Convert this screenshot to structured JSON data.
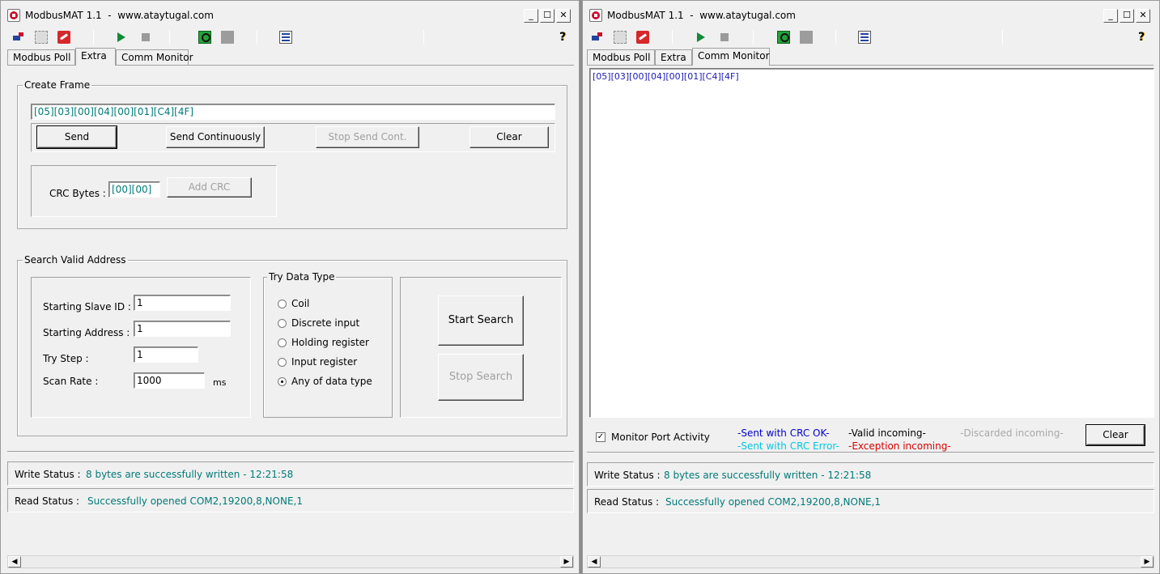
{
  "title": "ModbusMAT 1.1  -  www.ataytugal.com",
  "window_buttons": {
    "minimize": "_",
    "maximize": "☐",
    "close": "✕"
  },
  "toolbar": {
    "help": "?"
  },
  "tabs": [
    "Modbus Poll",
    "Extra",
    "Comm Monitor"
  ],
  "left": {
    "active_tab": "Extra",
    "create_frame": {
      "title": "Create Frame",
      "frame_value": "[05][03][00][04][00][01][C4][4F]",
      "send": "Send",
      "send_continuously": "Send Continuously",
      "stop_send_cont": "Stop Send Cont.",
      "clear": "Clear",
      "crc_label": "CRC Bytes :",
      "crc_value": "[00][00]",
      "add_crc": "Add CRC"
    },
    "search": {
      "title": "Search Valid Address",
      "starting_slave_id_label": "Starting Slave ID :",
      "starting_slave_id": "1",
      "starting_address_label": "Starting Address :",
      "starting_address": "1",
      "try_step_label": "Try Step :",
      "try_step": "1",
      "scan_rate_label": "Scan Rate :",
      "scan_rate": "1000",
      "scan_rate_unit": "ms",
      "data_type_title": "Try Data Type",
      "data_types": [
        "Coil",
        "Discrete input",
        "Holding register",
        "Input register",
        "Any of data type"
      ],
      "selected_data_type": "Any of data type",
      "start_search": "Start Search",
      "stop_search": "Stop Search"
    }
  },
  "right": {
    "active_tab": "Comm Monitor",
    "monitor_text": "[05][03][00][04][00][01][C4][4F]",
    "monitor_port_activity": "Monitor Port Activity",
    "monitor_checked": true,
    "legend": {
      "sent_ok": "-Sent with CRC OK-",
      "sent_err": "-Sent with CRC Error-",
      "valid_in": "-Valid incoming-",
      "exception_in": "-Exception incoming-",
      "discarded_in": "-Discarded incoming-"
    },
    "clear": "Clear"
  },
  "status": {
    "write_label": "Write Status :",
    "write_value": "8 bytes are successfully written - 12:21:58",
    "read_label": "Read Status :",
    "read_value": "Successfully opened COM2,19200,8,NONE,1"
  },
  "colors": {
    "status_text": "#007a78",
    "monitor_text": "#1a1ab8",
    "sent_ok": "#0000cc",
    "sent_err": "#00c8e0",
    "valid_in": "#000000",
    "exception_in": "#d80000",
    "discarded_in": "#a8a8a8"
  }
}
